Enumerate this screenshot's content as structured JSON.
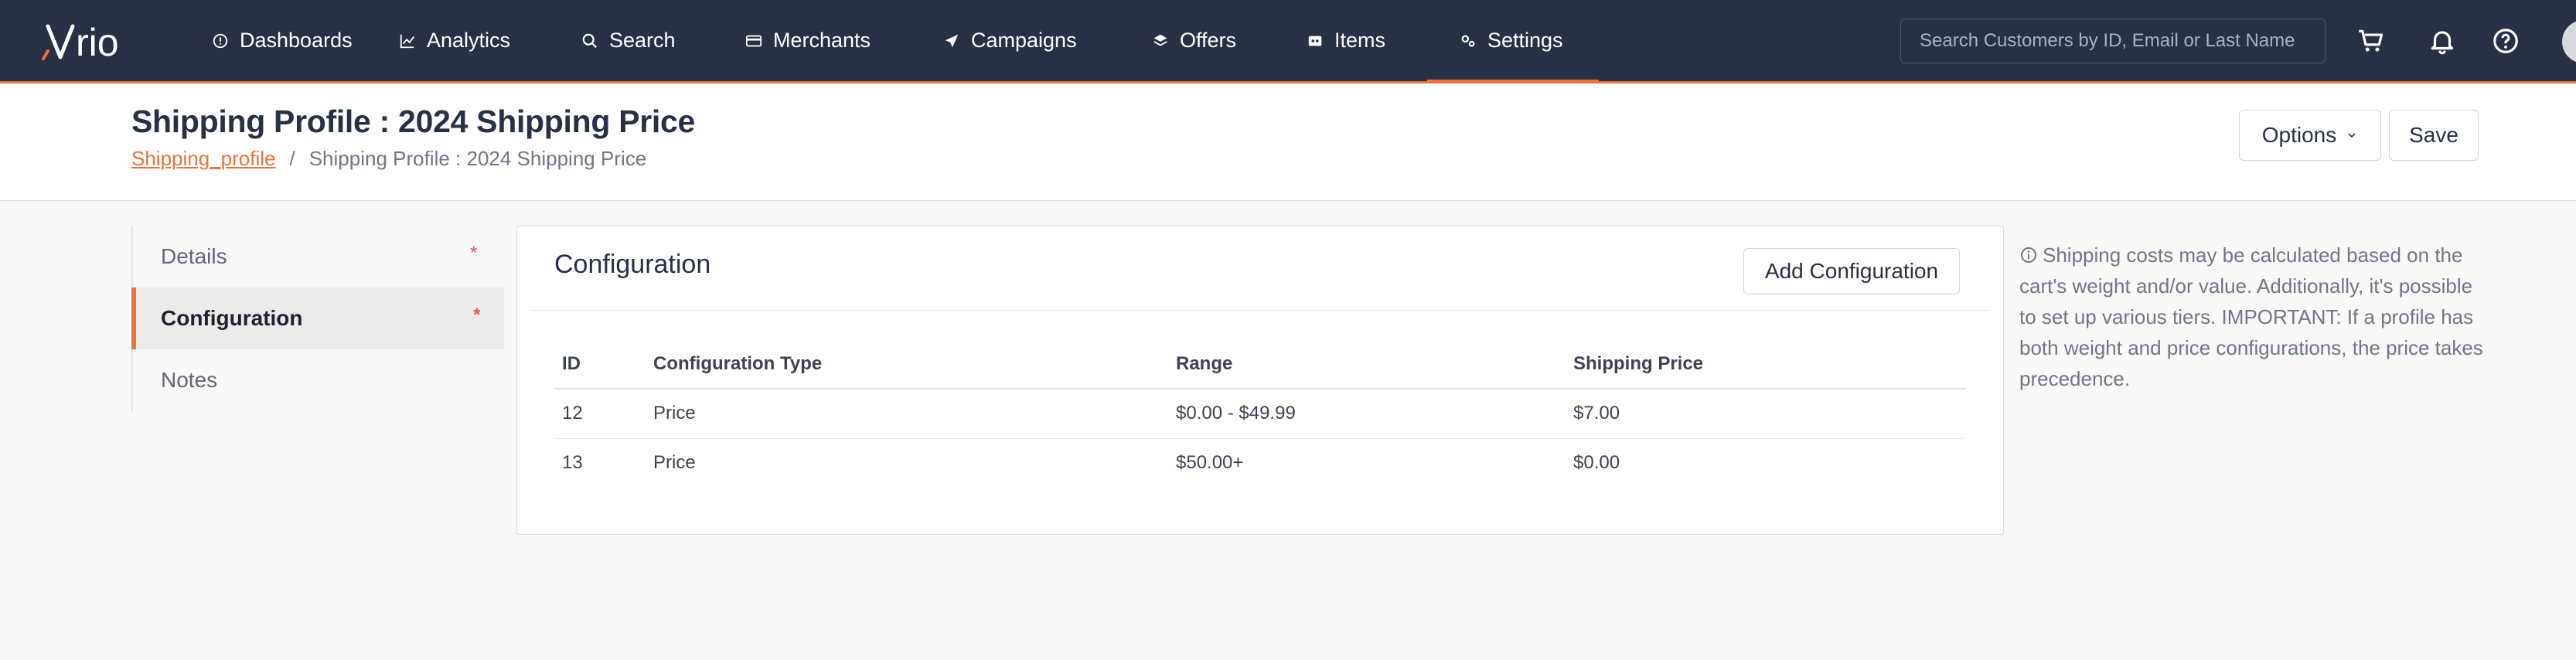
{
  "app": {
    "logo_text": "vrio"
  },
  "nav": {
    "items": [
      {
        "label": "Dashboards",
        "icon": "dashboard-icon"
      },
      {
        "label": "Analytics",
        "icon": "chart-line-icon"
      },
      {
        "label": "Search",
        "icon": "search-icon"
      },
      {
        "label": "Merchants",
        "icon": "credit-card-icon"
      },
      {
        "label": "Campaigns",
        "icon": "send-icon"
      },
      {
        "label": "Offers",
        "icon": "layers-icon"
      },
      {
        "label": "Items",
        "icon": "box-icon"
      },
      {
        "label": "Settings",
        "icon": "settings-icon",
        "active": true
      }
    ],
    "search_placeholder": "Search Customers by ID, Email or Last Name",
    "icons": [
      "cart-icon",
      "bell-icon",
      "help-icon"
    ]
  },
  "header": {
    "title": "Shipping Profile : 2024 Shipping Price",
    "breadcrumb": {
      "link": "Shipping_profile",
      "separator": "/",
      "current": "Shipping Profile : 2024 Shipping Price"
    },
    "options_label": "Options",
    "save_label": "Save"
  },
  "sidetabs": [
    {
      "label": "Details",
      "required": "*"
    },
    {
      "label": "Configuration",
      "required": "*",
      "active": true
    },
    {
      "label": "Notes"
    }
  ],
  "configuration": {
    "title": "Configuration",
    "add_label": "Add Configuration",
    "columns": [
      "ID",
      "Configuration Type",
      "Range",
      "Shipping Price"
    ],
    "rows": [
      {
        "id": "12",
        "type": "Price",
        "range": "$0.00 - $49.99",
        "price": "$7.00"
      },
      {
        "id": "13",
        "type": "Price",
        "range": "$50.00+",
        "price": "$0.00"
      }
    ]
  },
  "help_text": "Shipping costs may be calculated based on the cart's weight and/or value. Additionally, it's possible to set up various tiers. IMPORTANT: If a profile has both weight and price configurations, the price takes precedence.",
  "colors": {
    "nav_bg": "#283046",
    "accent": "#e8743b",
    "required": "#ea5455"
  }
}
